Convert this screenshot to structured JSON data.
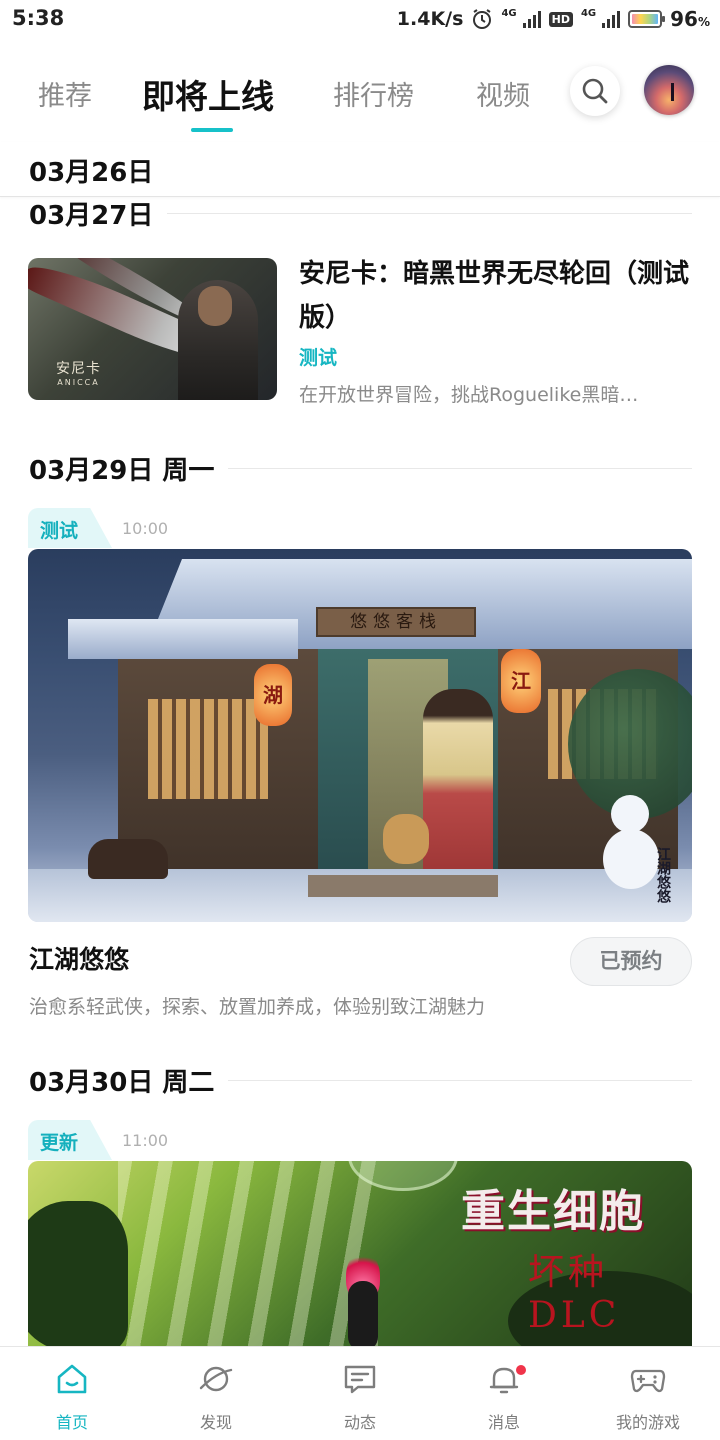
{
  "status_bar": {
    "time": "5:38",
    "net_speed": "1.4K/s",
    "hd_label": "HD",
    "net_type_1": "4G",
    "net_type_2": "4G",
    "battery_percent": "96",
    "battery_unit": "%"
  },
  "top_tabs": [
    {
      "label": "推荐",
      "active": false
    },
    {
      "label": "即将上线",
      "active": true
    },
    {
      "label": "排行榜",
      "active": false
    },
    {
      "label": "视频",
      "active": false
    }
  ],
  "sticky_date": "03月26日",
  "sections": [
    {
      "date": "03月27日",
      "games": [
        {
          "title": "安尼卡：暗黑世界无尽轮回（测试版）",
          "tag": "测试",
          "description": "在开放世界冒险，挑战Roguelike黑暗…",
          "thumb_logo": "安尼卡",
          "thumb_logo_sub": "ANICCA"
        }
      ]
    },
    {
      "date": "03月29日 周一",
      "games": [
        {
          "badge": "测试",
          "time": "10:00",
          "title": "江湖悠悠",
          "button": "已预约",
          "description": "治愈系轻武侠，探索、放置加养成，体验别致江湖魅力",
          "banner_lantern_left": "湖",
          "banner_lantern_right": "江",
          "banner_sign": "悠悠客栈",
          "banner_logo": "江湖悠悠"
        }
      ]
    },
    {
      "date": "03月30日 周二",
      "games": [
        {
          "badge": "更新",
          "time": "11:00",
          "banner_title": "重生细胞",
          "banner_subtitle": "坏种DLC"
        }
      ]
    }
  ],
  "bottom_nav": [
    {
      "label": "首页",
      "icon": "home-icon",
      "active": true
    },
    {
      "label": "发现",
      "icon": "planet-icon",
      "active": false
    },
    {
      "label": "动态",
      "icon": "chat-icon",
      "active": false
    },
    {
      "label": "消息",
      "icon": "bell-icon",
      "active": false,
      "badge_dot": true
    },
    {
      "label": "我的游戏",
      "icon": "gamepad-icon",
      "active": false
    }
  ],
  "colors": {
    "accent": "#16c1c9",
    "accent_text": "#16b6c2",
    "badge_bg": "#e2f7f8",
    "notification_dot": "#f0344a"
  }
}
